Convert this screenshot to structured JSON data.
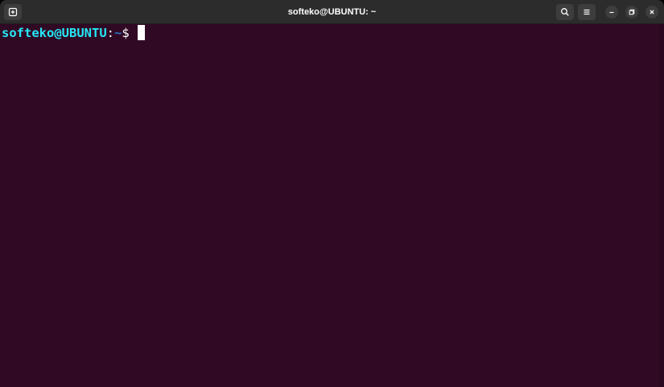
{
  "window": {
    "title": "softeko@UBUNTU: ~",
    "background": "#300a24"
  },
  "titlebar": {
    "new_tab_icon": "new-tab-icon",
    "search_icon": "search-icon",
    "menu_icon": "hamburger-menu-icon",
    "minimize_icon": "minimize-icon",
    "maximize_icon": "maximize-icon",
    "close_icon": "close-icon"
  },
  "terminal": {
    "prompt_user": "softeko@UBUNTU",
    "prompt_sep": ":",
    "prompt_path": "~",
    "prompt_sign": "$ ",
    "user_color": "#26e6f5",
    "path_color": "#2e73c8"
  }
}
